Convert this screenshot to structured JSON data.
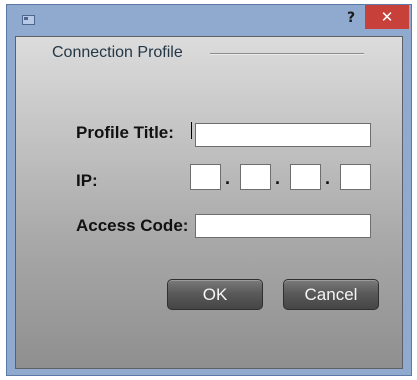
{
  "titlebar": {
    "help_label": "?",
    "close_label": "✕"
  },
  "group": {
    "title": "Connection Profile"
  },
  "fields": {
    "profile_title": {
      "label": "Profile Title:",
      "value": ""
    },
    "ip": {
      "label": "IP:",
      "octets": [
        "",
        "",
        "",
        ""
      ],
      "separator": "."
    },
    "access_code": {
      "label": "Access Code:",
      "value": ""
    }
  },
  "buttons": {
    "ok": "OK",
    "cancel": "Cancel"
  },
  "colors": {
    "titlebar": "#8fa9cf",
    "close_button": "#c7403a",
    "panel_top": "#dcdcdc",
    "panel_bottom": "#8f8f8f",
    "group_title": "#243746",
    "button_face": "#5a5a5a"
  }
}
